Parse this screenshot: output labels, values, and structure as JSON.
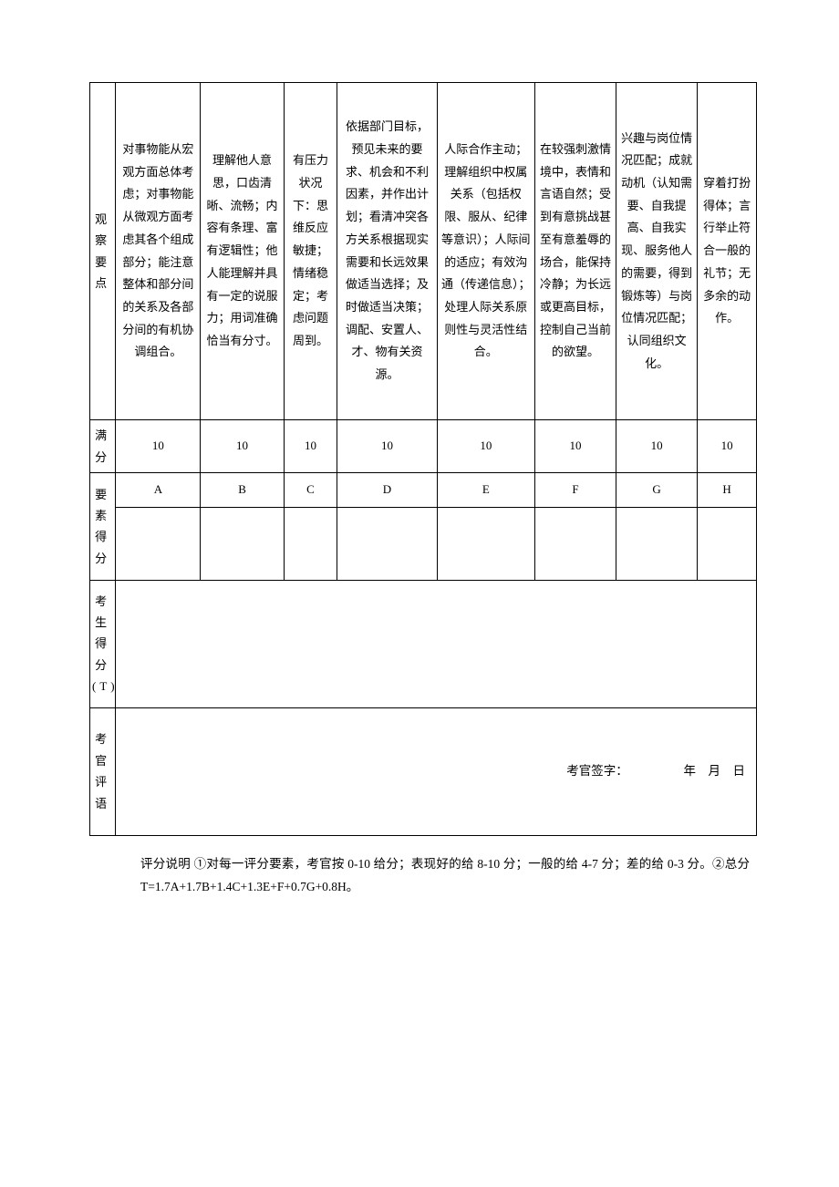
{
  "labels": {
    "row_obs": "观察要点",
    "row_full": "满分",
    "row_elem": "要素得分",
    "row_cand": "考生得分(T)",
    "row_remark": "考官评语"
  },
  "obs": {
    "c1": "对事物能从宏观方面总体考虑；对事物能从微观方面考虑其各个组成部分；能注意整体和部分间的关系及各部分间的有机协调组合。",
    "c2": "理解他人意思，口齿清晰、流畅；内容有条理、富有逻辑性；他人能理解并具有一定的说服力；用词准确恰当有分寸。",
    "c3": "有压力状况下：思维反应敏捷；情绪稳定；考虑问题周到。",
    "c4": "依据部门目标，预见未来的要求、机会和不利因素，并作出计划；看清冲突各方关系根据现实需要和长远效果做适当选择；及时做适当决策；调配、安置人、才、物有关资源。",
    "c5": "人际合作主动；理解组织中权属关系（包括权限、服从、纪律等意识）；人际间的适应；有效沟通（传递信息）；处理人际关系原则性与灵活性结合。",
    "c6": "在较强刺激情境中，表情和言语自然；受到有意挑战甚至有意羞辱的场合，能保持冷静；为长远或更高目标，控制自己当前的欲望。",
    "c7": "兴趣与岗位情况匹配；成就动机（认知需要、自我提高、自我实现、服务他人的需要，得到锻炼等）与岗位情况匹配；认同组织文化。",
    "c8": "穿着打扮得体；言行举止符合一般的礼节；无多余的动作。"
  },
  "full": {
    "c1": "10",
    "c2": "10",
    "c3": "10",
    "c4": "10",
    "c5": "10",
    "c6": "10",
    "c7": "10",
    "c8": "10"
  },
  "elem": {
    "c1": "A",
    "c2": "B",
    "c3": "C",
    "c4": "D",
    "c5": "E",
    "c6": "F",
    "c7": "G",
    "c8": "H"
  },
  "signature": "考官签字：　　　　　年　月　日",
  "notes": "评分说明 ①对每一评分要素，考官按 0-10 给分；表现好的给 8-10 分；一般的给 4-7 分；差的给 0-3 分。②总分 T=1.7A+1.7B+1.4C+1.3E+F+0.7G+0.8H。"
}
